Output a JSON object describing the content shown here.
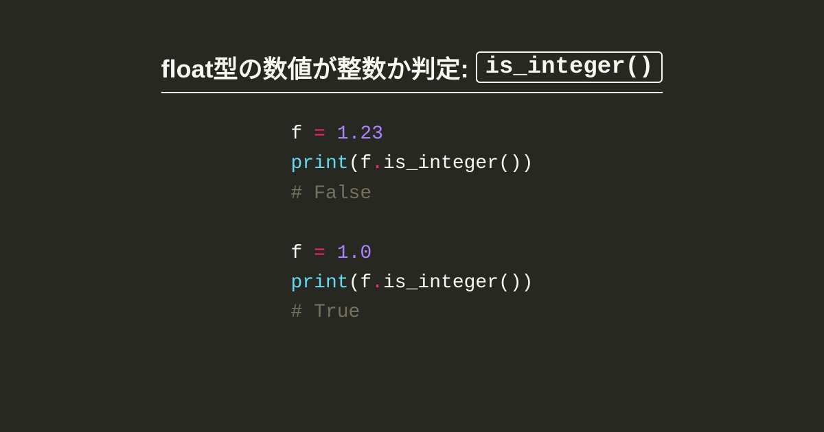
{
  "heading": {
    "text": "float型の数値が整数か判定: ",
    "code": "is_integer()"
  },
  "code": {
    "lines": [
      [
        {
          "cls": "tok-name",
          "t": "f"
        },
        {
          "cls": "tok-space",
          "t": " "
        },
        {
          "cls": "tok-op",
          "t": "="
        },
        {
          "cls": "tok-space",
          "t": " "
        },
        {
          "cls": "tok-num",
          "t": "1.23"
        }
      ],
      [
        {
          "cls": "tok-builtin",
          "t": "print"
        },
        {
          "cls": "tok-punct",
          "t": "("
        },
        {
          "cls": "tok-name",
          "t": "f"
        },
        {
          "cls": "tok-op",
          "t": "."
        },
        {
          "cls": "tok-name",
          "t": "is_integer"
        },
        {
          "cls": "tok-punct",
          "t": "())"
        }
      ],
      [
        {
          "cls": "tok-comment",
          "t": "# False"
        }
      ],
      [
        {
          "cls": "tok-space",
          "t": " "
        }
      ],
      [
        {
          "cls": "tok-name",
          "t": "f"
        },
        {
          "cls": "tok-space",
          "t": " "
        },
        {
          "cls": "tok-op",
          "t": "="
        },
        {
          "cls": "tok-space",
          "t": " "
        },
        {
          "cls": "tok-num",
          "t": "1.0"
        }
      ],
      [
        {
          "cls": "tok-builtin",
          "t": "print"
        },
        {
          "cls": "tok-punct",
          "t": "("
        },
        {
          "cls": "tok-name",
          "t": "f"
        },
        {
          "cls": "tok-op",
          "t": "."
        },
        {
          "cls": "tok-name",
          "t": "is_integer"
        },
        {
          "cls": "tok-punct",
          "t": "())"
        }
      ],
      [
        {
          "cls": "tok-comment",
          "t": "# True"
        }
      ]
    ]
  }
}
